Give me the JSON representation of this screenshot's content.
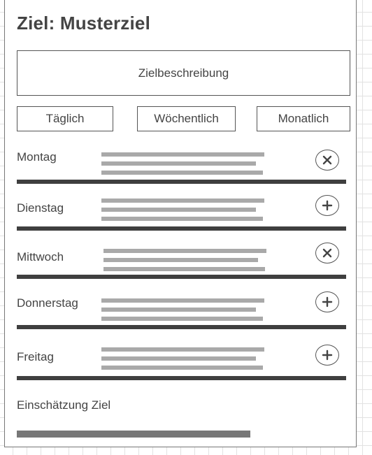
{
  "header": {
    "title": "Ziel: Musterziel"
  },
  "description": {
    "label": "Zielbeschreibung"
  },
  "frequency": {
    "daily": "Täglich",
    "weekly": "Wöchentlich",
    "monthly": "Monatlich"
  },
  "days": [
    {
      "label": "Montag",
      "action": "remove",
      "action_icon": "close-icon"
    },
    {
      "label": "Dienstag",
      "action": "add",
      "action_icon": "plus-icon"
    },
    {
      "label": "Mittwoch",
      "action": "remove",
      "action_icon": "close-icon"
    },
    {
      "label": "Donnerstag",
      "action": "add",
      "action_icon": "plus-icon"
    },
    {
      "label": "Freitag",
      "action": "add",
      "action_icon": "plus-icon"
    }
  ],
  "rating": {
    "label": "Einschätzung Ziel",
    "level": 0.7
  },
  "colors": {
    "separator": "#3f3f3f",
    "placeholder_text": "#a9a9a9",
    "rating_bar": "#777777"
  }
}
